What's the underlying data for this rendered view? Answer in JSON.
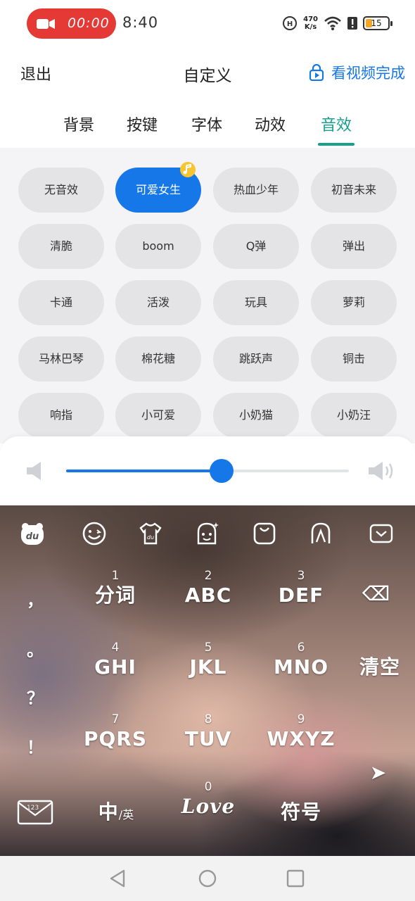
{
  "status_bar": {
    "recording_time": "00:00",
    "clock": "8:40",
    "net_speed_value": "470",
    "net_speed_unit": "K/s",
    "battery": "15",
    "icons": [
      "camera-icon",
      "hd-volte-icon",
      "wifi-icon",
      "alert-icon",
      "battery-icon"
    ]
  },
  "header": {
    "exit_label": "退出",
    "title": "自定义",
    "watch_video_label": "看视频完成",
    "accent_color": "#1677e8"
  },
  "tabs": [
    {
      "label": "背景",
      "active": false
    },
    {
      "label": "按键",
      "active": false
    },
    {
      "label": "字体",
      "active": false
    },
    {
      "label": "动效",
      "active": false
    },
    {
      "label": "音效",
      "active": true
    }
  ],
  "sound_effects": [
    {
      "label": "无音效",
      "selected": false
    },
    {
      "label": "可爱女生",
      "selected": true
    },
    {
      "label": "热血少年",
      "selected": false
    },
    {
      "label": "初音未来",
      "selected": false
    },
    {
      "label": "清脆",
      "selected": false
    },
    {
      "label": "boom",
      "selected": false
    },
    {
      "label": "Q弹",
      "selected": false
    },
    {
      "label": "弹出",
      "selected": false
    },
    {
      "label": "卡通",
      "selected": false
    },
    {
      "label": "活泼",
      "selected": false
    },
    {
      "label": "玩具",
      "selected": false
    },
    {
      "label": "萝莉",
      "selected": false
    },
    {
      "label": "马林巴琴",
      "selected": false
    },
    {
      "label": "棉花糖",
      "selected": false
    },
    {
      "label": "跳跃声",
      "selected": false
    },
    {
      "label": "铜击",
      "selected": false
    },
    {
      "label": "响指",
      "selected": false
    },
    {
      "label": "小可爱",
      "selected": false
    },
    {
      "label": "小奶猫",
      "selected": false
    },
    {
      "label": "小奶汪",
      "selected": false
    }
  ],
  "volume": {
    "level": 0.55
  },
  "keyboard": {
    "toolbar_icons": [
      "du-logo-icon",
      "emoji-icon",
      "skin-icon",
      "sticker-icon",
      "clipboard-icon",
      "handwrite-icon",
      "collapse-keyboard-icon"
    ],
    "punctuation": [
      "，",
      "。",
      "？",
      "！"
    ],
    "keys": [
      {
        "num": "1",
        "label": "分词"
      },
      {
        "num": "2",
        "label": "ABC"
      },
      {
        "num": "3",
        "label": "DEF"
      },
      {
        "num": "",
        "label": "⌫"
      },
      {
        "num": "4",
        "label": "GHI"
      },
      {
        "num": "5",
        "label": "JKL"
      },
      {
        "num": "6",
        "label": "MNO"
      },
      {
        "num": "",
        "label": "清空"
      },
      {
        "num": "7",
        "label": "PQRS"
      },
      {
        "num": "8",
        "label": "TUV"
      },
      {
        "num": "9",
        "label": "WXYZ"
      },
      {
        "num": "",
        "label": "➤"
      }
    ],
    "bottom_keys": {
      "numbers_label": "123",
      "lang_label_main": "中",
      "lang_label_sub": "/英",
      "space_num": "0",
      "space_label": "Love",
      "symbols_label": "符号"
    }
  },
  "nav_bar": {
    "icons": [
      "back-icon",
      "home-icon",
      "recents-icon"
    ]
  }
}
